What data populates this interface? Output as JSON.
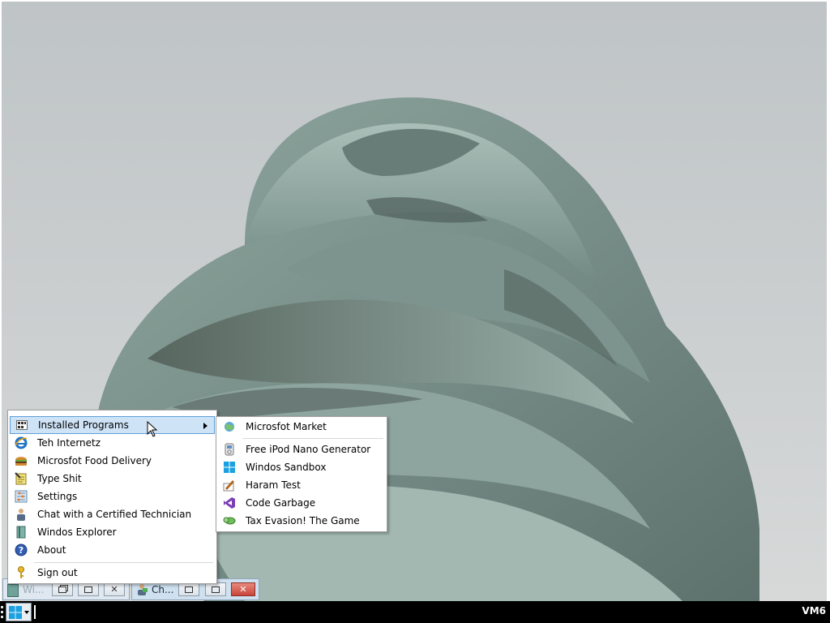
{
  "start_menu": {
    "items": [
      {
        "label": "Installed Programs",
        "icon": "programs-grid-icon",
        "highlighted": true,
        "has_submenu": true
      },
      {
        "label": "Teh Internetz",
        "icon": "internet-explorer-icon"
      },
      {
        "label": "Microsfot Food Delivery",
        "icon": "burger-icon"
      },
      {
        "label": "Type Shit",
        "icon": "notepad-icon"
      },
      {
        "label": "Settings",
        "icon": "settings-icon"
      },
      {
        "label": "Chat with a Certified Technician",
        "icon": "technician-icon"
      },
      {
        "label": "Windos Explorer",
        "icon": "explorer-book-icon"
      },
      {
        "label": "About",
        "icon": "help-icon"
      }
    ],
    "sign_out": {
      "label": "Sign out",
      "icon": "key-icon"
    }
  },
  "submenu": {
    "items": [
      {
        "label": "Microsfot Market",
        "icon": "market-icon"
      },
      {
        "label": "Free iPod Nano Generator",
        "icon": "ipod-icon"
      },
      {
        "label": "Windos Sandbox",
        "icon": "windows-logo-icon"
      },
      {
        "label": "Haram Test",
        "icon": "pen-paper-icon"
      },
      {
        "label": "Code Garbage",
        "icon": "visual-studio-icon"
      },
      {
        "label": "Tax Evasion! The Game",
        "icon": "money-icon"
      }
    ]
  },
  "taskbar": {
    "windows": [
      {
        "title": "Wi...",
        "icon": "explorer-book-icon",
        "active": false
      },
      {
        "title": "Ch...",
        "icon": "technician-icon",
        "active": true
      }
    ],
    "clock_label": "VM6"
  },
  "colors": {
    "highlight_bg": "#cfe3f7",
    "highlight_border": "#5f9ed9",
    "taskbar_bg": "#000000",
    "close_button": "#c9463a"
  }
}
